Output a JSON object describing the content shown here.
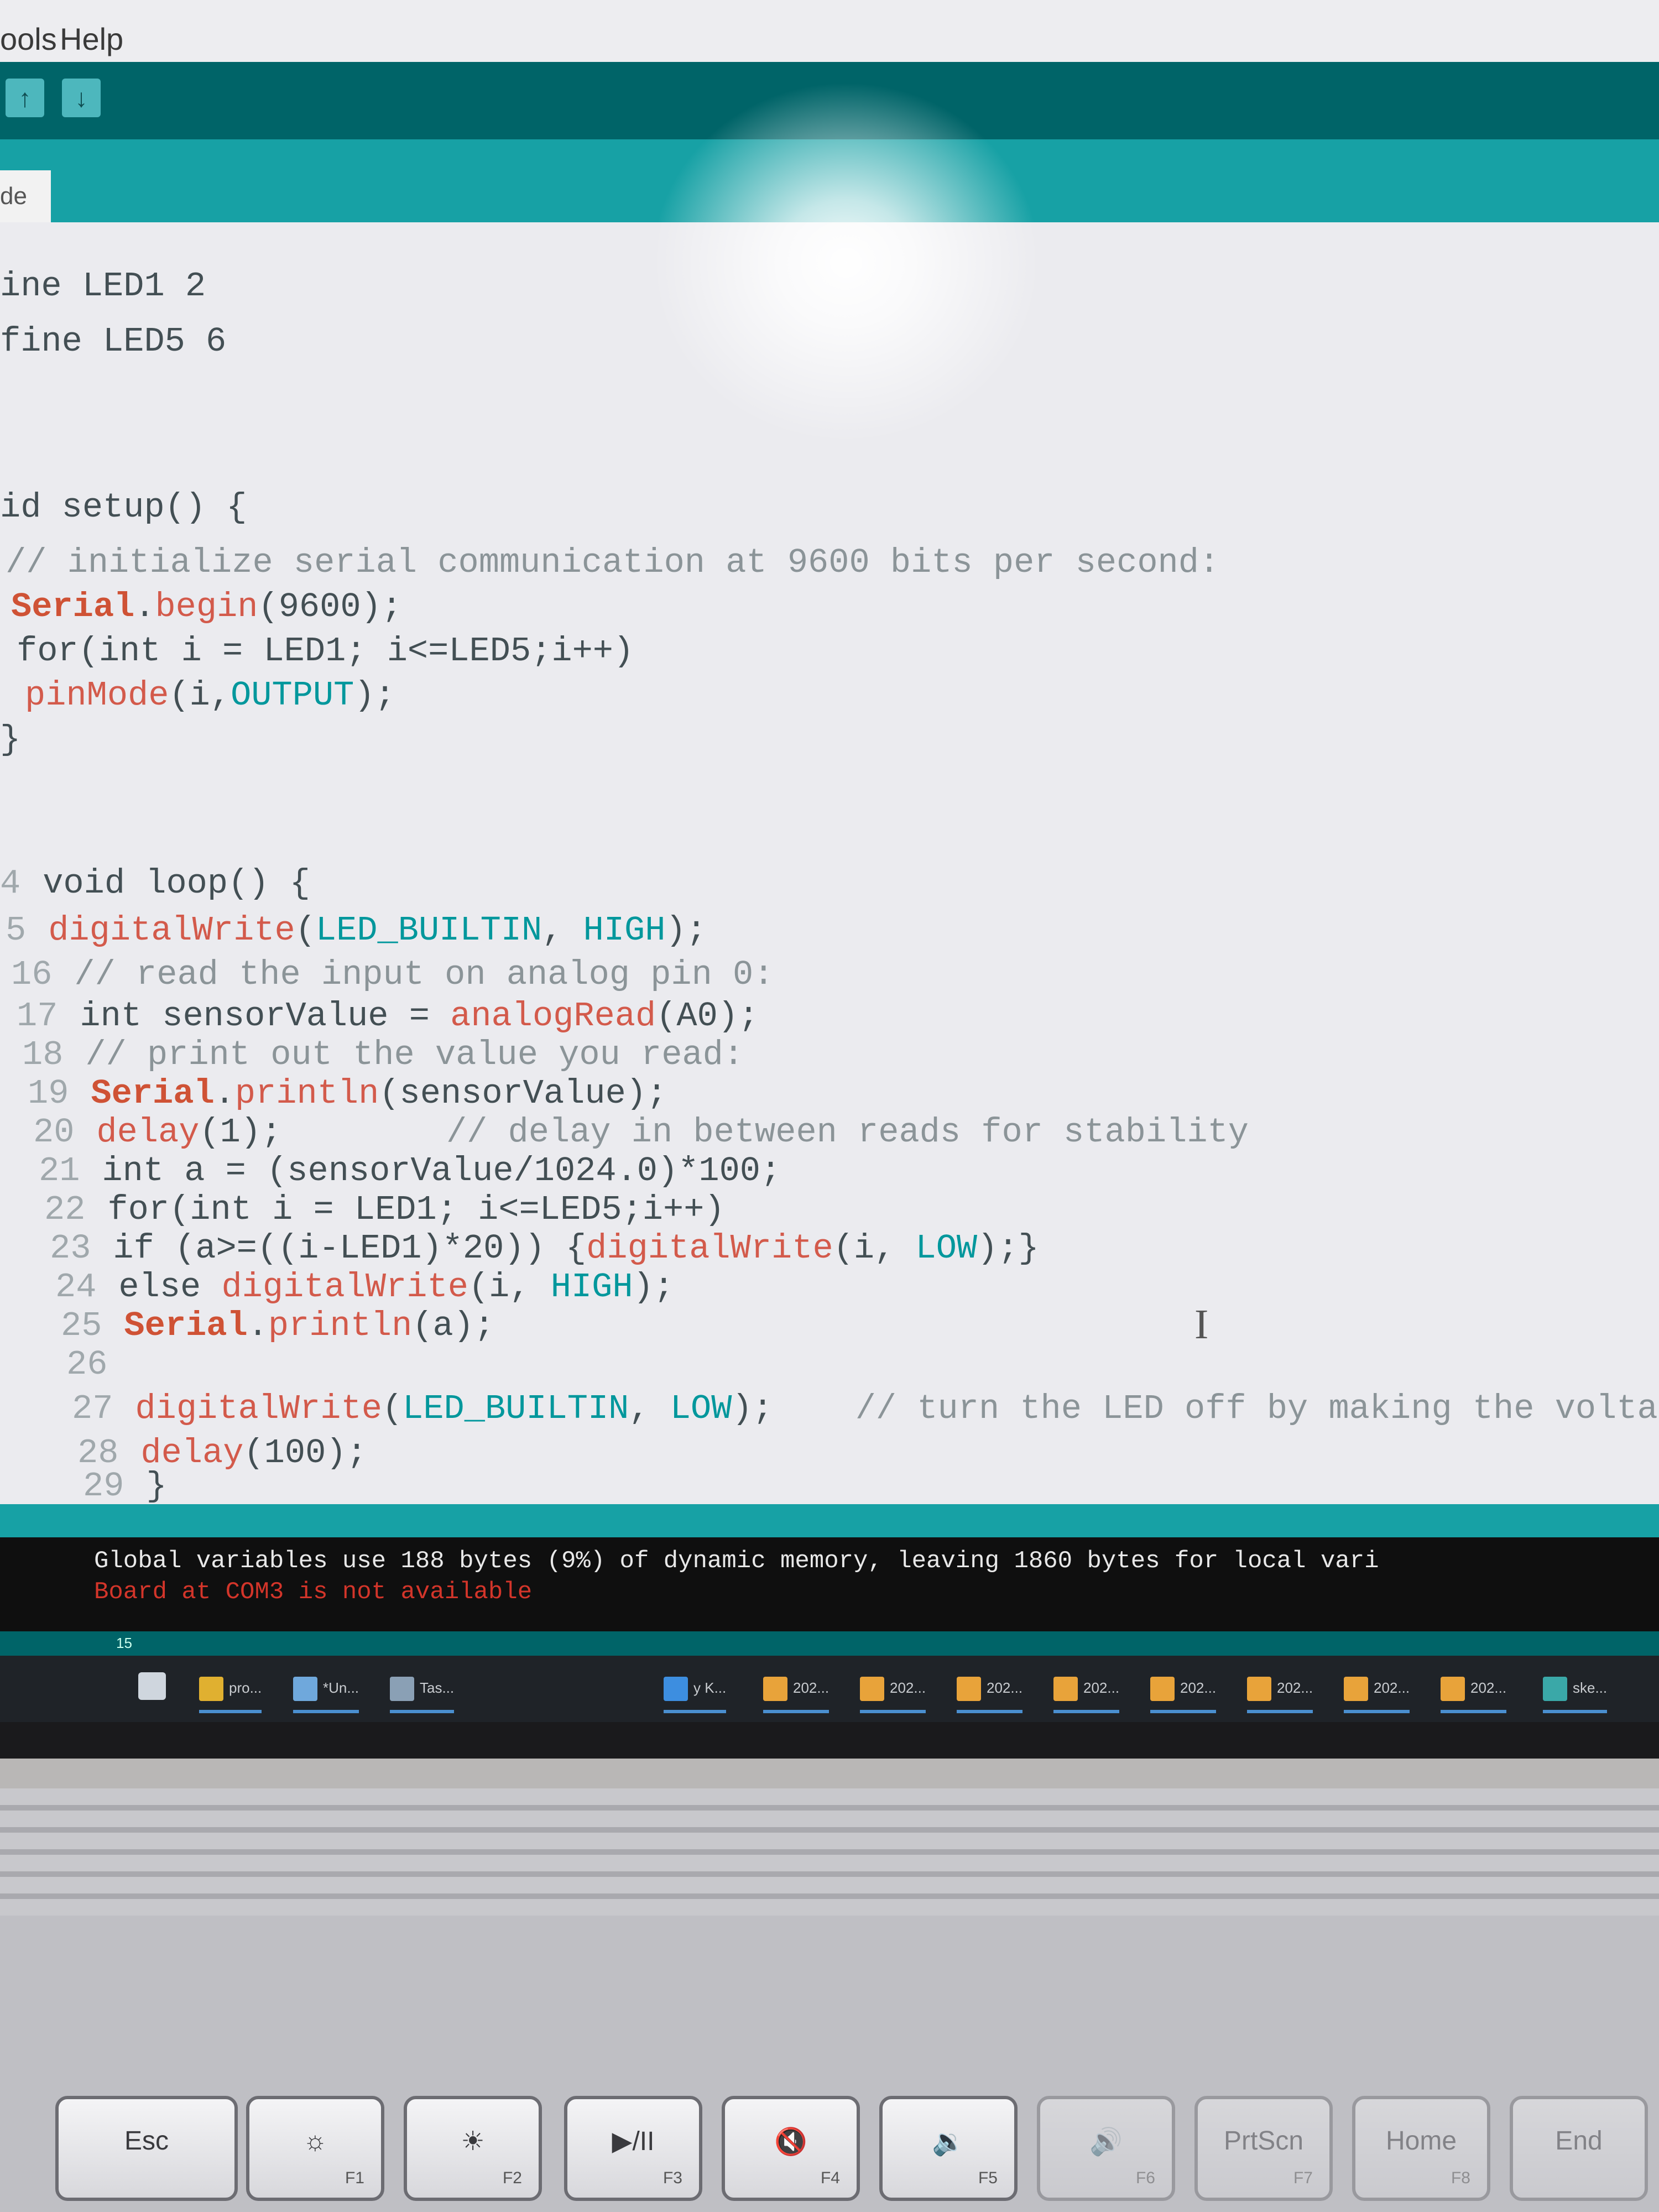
{
  "menubar": {
    "items": [
      "ools",
      "Help"
    ]
  },
  "toolbar": {
    "upload_glyph": "↑",
    "download_glyph": "↓"
  },
  "tab": {
    "label": "de"
  },
  "code": {
    "lines": [
      {
        "n": "",
        "parts": [
          [
            "",
            "ine LED1 2"
          ]
        ]
      },
      {
        "n": "",
        "parts": [
          [
            "",
            "fine LED5 6"
          ]
        ]
      },
      {
        "n": "",
        "parts": [
          [
            "",
            "id setup() {"
          ]
        ]
      },
      {
        "n": "",
        "parts": [
          [
            "cm",
            "// initialize serial communication at 9600 bits per second:"
          ]
        ]
      },
      {
        "n": "",
        "parts": [
          [
            "kw",
            "Serial"
          ],
          [
            "",
            "."
          ],
          [
            "fn",
            "begin"
          ],
          [
            "",
            "(9600);"
          ]
        ]
      },
      {
        "n": "",
        "parts": [
          [
            "",
            "for(int i = LED1; i<=LED5;i++)"
          ]
        ]
      },
      {
        "n": "",
        "parts": [
          [
            "fn",
            "pinMode"
          ],
          [
            "",
            "(i,"
          ],
          [
            "cn",
            "OUTPUT"
          ],
          [
            "",
            ");"
          ]
        ]
      },
      {
        "n": "",
        "parts": [
          [
            "",
            "}"
          ]
        ]
      },
      {
        "n": "4",
        "parts": [
          [
            "",
            "void loop() {"
          ]
        ]
      },
      {
        "n": "5",
        "parts": [
          [
            "fn",
            "digitalWrite"
          ],
          [
            "",
            "("
          ],
          [
            "cn",
            "LED_BUILTIN"
          ],
          [
            "",
            ", "
          ],
          [
            "cn",
            "HIGH"
          ],
          [
            "",
            ");"
          ]
        ]
      },
      {
        "n": "16",
        "parts": [
          [
            "cm",
            "// read the input on analog pin 0:"
          ]
        ]
      },
      {
        "n": "17",
        "parts": [
          [
            "",
            "int sensorValue = "
          ],
          [
            "fn",
            "analogRead"
          ],
          [
            "",
            "(A0);"
          ]
        ]
      },
      {
        "n": "18",
        "parts": [
          [
            "cm",
            "// print out the value you read:"
          ]
        ]
      },
      {
        "n": "19",
        "parts": [
          [
            "kw",
            "Serial"
          ],
          [
            "",
            "."
          ],
          [
            "fn",
            "println"
          ],
          [
            "",
            "(sensorValue);"
          ]
        ]
      },
      {
        "n": "20",
        "parts": [
          [
            "fn",
            "delay"
          ],
          [
            "",
            "(1);        "
          ],
          [
            "cm",
            "// delay in between reads for stability"
          ]
        ]
      },
      {
        "n": "21",
        "parts": [
          [
            "",
            "int a = (sensorValue/1024.0)*100;"
          ]
        ]
      },
      {
        "n": "22",
        "parts": [
          [
            "",
            "for(int i = LED1; i<=LED5;i++)"
          ]
        ]
      },
      {
        "n": "23",
        "parts": [
          [
            "",
            "if (a>=((i-LED1)*20)) {"
          ],
          [
            "fn",
            "digitalWrite"
          ],
          [
            "",
            "(i, "
          ],
          [
            "cn",
            "LOW"
          ],
          [
            "",
            ");}"
          ]
        ]
      },
      {
        "n": "24",
        "parts": [
          [
            "",
            "else "
          ],
          [
            "fn",
            "digitalWrite"
          ],
          [
            "",
            "(i, "
          ],
          [
            "cn",
            "HIGH"
          ],
          [
            "",
            ");"
          ]
        ]
      },
      {
        "n": "25",
        "parts": [
          [
            "kw",
            "Serial"
          ],
          [
            "",
            "."
          ],
          [
            "fn",
            "println"
          ],
          [
            "",
            "(a);"
          ]
        ]
      },
      {
        "n": "26",
        "parts": [
          [
            "",
            ""
          ]
        ]
      },
      {
        "n": "27",
        "parts": [
          [
            "fn",
            "digitalWrite"
          ],
          [
            "",
            "("
          ],
          [
            "cn",
            "LED_BUILTIN"
          ],
          [
            "",
            ", "
          ],
          [
            "cn",
            "LOW"
          ],
          [
            "",
            ");    "
          ],
          [
            "cm",
            "// turn the LED off by making the voltage LOW"
          ]
        ]
      },
      {
        "n": "28",
        "parts": [
          [
            "fn",
            "delay"
          ],
          [
            "",
            "(100);"
          ]
        ]
      },
      {
        "n": "29",
        "parts": [
          [
            "",
            "}"
          ]
        ]
      }
    ]
  },
  "console": {
    "line1": "Global variables use 188 bytes (9%) of dynamic memory, leaving 1860 bytes for local vari",
    "line2": "Board at COM3 is not available",
    "line1_color": "#e8e8e8",
    "line2_color": "#d3352a"
  },
  "status": {
    "line_number": "15"
  },
  "taskbar": {
    "items": [
      {
        "label": "pro...",
        "color": "#e0b030"
      },
      {
        "label": "*Un...",
        "color": "#6fa8dc"
      },
      {
        "label": "Tas...",
        "color": "#8aa0b5"
      },
      {
        "label": "y K...",
        "color": "#3d8ee0"
      },
      {
        "label": "202...",
        "color": "#e8a33a"
      },
      {
        "label": "202...",
        "color": "#e8a33a"
      },
      {
        "label": "202...",
        "color": "#e8a33a"
      },
      {
        "label": "202...",
        "color": "#e8a33a"
      },
      {
        "label": "202...",
        "color": "#e8a33a"
      },
      {
        "label": "202...",
        "color": "#e8a33a"
      },
      {
        "label": "202...",
        "color": "#e8a33a"
      },
      {
        "label": "202...",
        "color": "#e8a33a"
      },
      {
        "label": "ske...",
        "color": "#3aa8a8"
      }
    ]
  },
  "keyboard": {
    "keys": [
      {
        "main": "Esc",
        "fn": ""
      },
      {
        "main": "☼",
        "fn": "F1"
      },
      {
        "main": "☀",
        "fn": "F2"
      },
      {
        "main": "▶/II",
        "fn": "F3"
      },
      {
        "main": "🔇",
        "fn": "F4"
      },
      {
        "main": "🔉",
        "fn": "F5"
      },
      {
        "main": "🔊",
        "fn": "F6"
      },
      {
        "main": "PrtScn",
        "fn": "F7"
      },
      {
        "main": "Home",
        "fn": "F8"
      },
      {
        "main": "End",
        "fn": ""
      }
    ]
  }
}
